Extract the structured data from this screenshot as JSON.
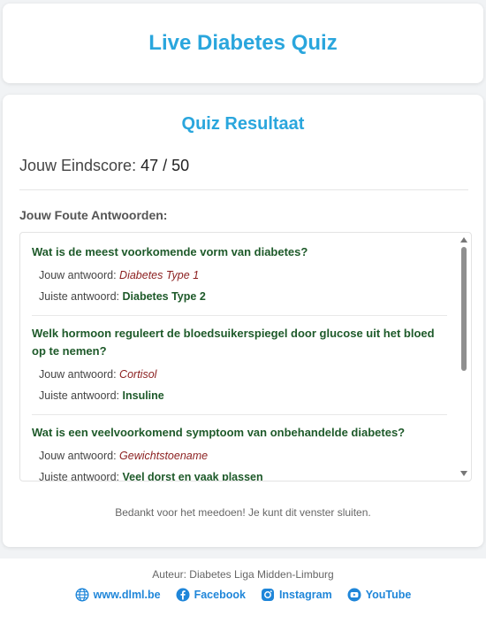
{
  "header": {
    "title": "Live Diabetes Quiz"
  },
  "result": {
    "title": "Quiz Resultaat",
    "score_label": "Jouw Eindscore:",
    "score_value": "47 / 50",
    "wrong_heading": "Jouw Foute Antwoorden:",
    "your_answer_label": "Jouw antwoord:",
    "correct_answer_label": "Juiste antwoord:",
    "questions": [
      {
        "question": "Wat is de meest voorkomende vorm van diabetes?",
        "your_answer": "Diabetes Type 1",
        "correct_answer": "Diabetes Type 2"
      },
      {
        "question": "Welk hormoon reguleert de bloedsuikerspiegel door glucose uit het bloed op te nemen?",
        "your_answer": "Cortisol",
        "correct_answer": "Insuline"
      },
      {
        "question": "Wat is een veelvoorkomend symptoom van onbehandelde diabetes?",
        "your_answer": "Gewichtstoename",
        "correct_answer": "Veel dorst en vaak plassen"
      }
    ],
    "thanks": "Bedankt voor het meedoen! Je kunt dit venster sluiten."
  },
  "footer": {
    "author": "Auteur: Diabetes Liga Midden-Limburg",
    "links": [
      {
        "label": "www.dlml.be",
        "icon": "globe-icon"
      },
      {
        "label": "Facebook",
        "icon": "facebook-icon"
      },
      {
        "label": "Instagram",
        "icon": "instagram-icon"
      },
      {
        "label": "YouTube",
        "icon": "youtube-icon"
      }
    ]
  },
  "colors": {
    "accent": "#2aa6dd",
    "correct": "#1e5a2a",
    "wrong": "#8b1f1f",
    "link": "#1f86d9"
  }
}
